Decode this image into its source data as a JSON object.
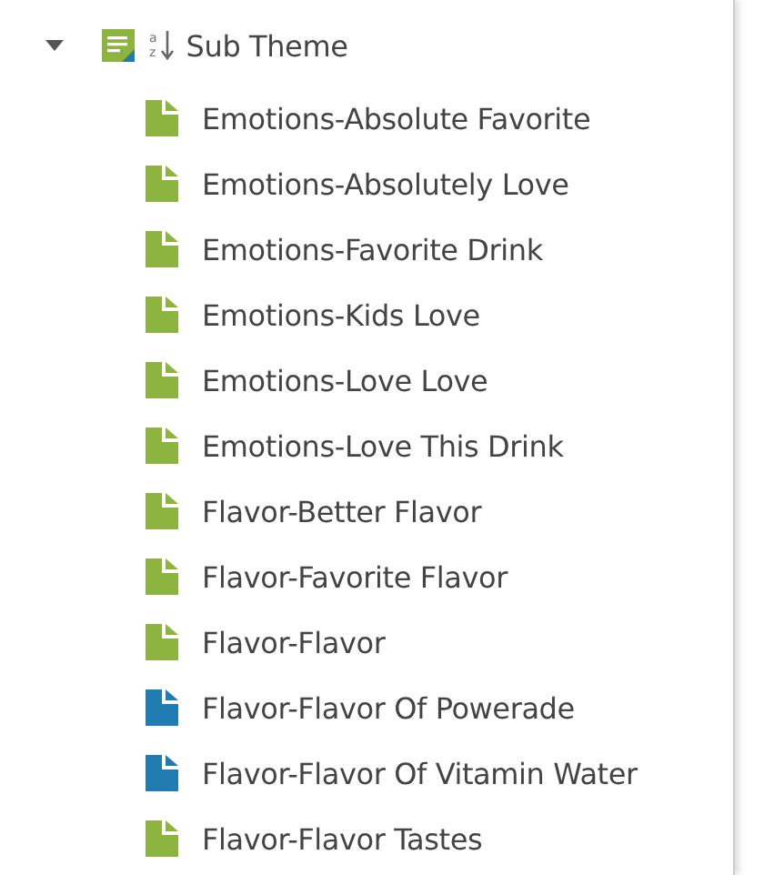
{
  "node": {
    "label": "Sub Theme",
    "expanded": true,
    "sort_letters": [
      "a",
      "z"
    ],
    "children": [
      {
        "label": "Emotions-Absolute Favorite",
        "color": "#8cb43f"
      },
      {
        "label": "Emotions-Absolutely Love",
        "color": "#8cb43f"
      },
      {
        "label": "Emotions-Favorite Drink",
        "color": "#8cb43f"
      },
      {
        "label": "Emotions-Kids Love",
        "color": "#8cb43f"
      },
      {
        "label": "Emotions-Love Love",
        "color": "#8cb43f"
      },
      {
        "label": "Emotions-Love This Drink",
        "color": "#8cb43f"
      },
      {
        "label": "Flavor-Better Flavor",
        "color": "#8cb43f"
      },
      {
        "label": "Flavor-Favorite Flavor",
        "color": "#8cb43f"
      },
      {
        "label": "Flavor-Flavor",
        "color": "#8cb43f"
      },
      {
        "label": "Flavor-Flavor Of Powerade",
        "color": "#1f7bb0"
      },
      {
        "label": "Flavor-Flavor Of Vitamin Water",
        "color": "#1f7bb0"
      },
      {
        "label": "Flavor-Flavor Tastes",
        "color": "#8cb43f"
      }
    ]
  }
}
